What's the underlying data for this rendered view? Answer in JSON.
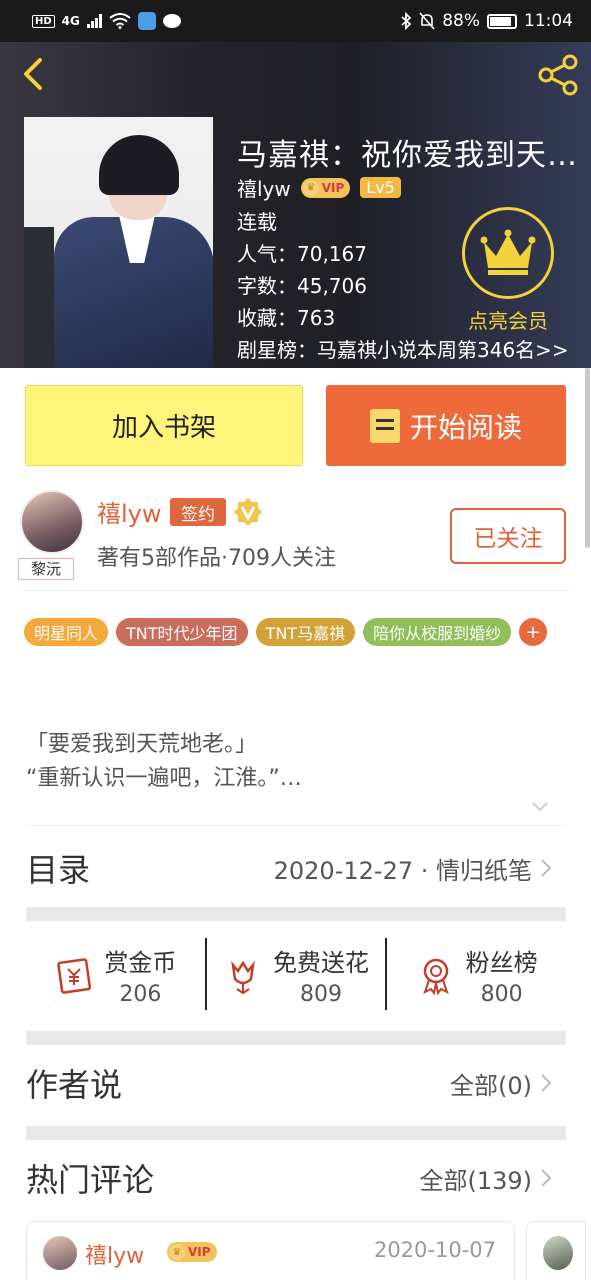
{
  "status_bar": {
    "left_icons": [
      "HD",
      "4G",
      "signal",
      "wifi",
      "app",
      "message"
    ],
    "battery": "88%",
    "time": "11:04"
  },
  "book": {
    "title": "马嘉祺：祝你爱我到天…",
    "author": "禧lyw",
    "vip": "VIP",
    "level": "Lv5",
    "status": "连载",
    "popularity": "人气：70,167",
    "words": "字数：45,706",
    "favorites": "收藏：763",
    "rank": "剧星榜：马嘉祺小说本周第346名>>",
    "member_label": "点亮会员"
  },
  "buttons": {
    "add_shelf": "加入书架",
    "start_read": "开始阅读"
  },
  "author": {
    "name": "禧lyw",
    "signed": "签约",
    "avatar_tag": "黎沅",
    "stats": "著有5部作品·709人关注",
    "follow": "已关注"
  },
  "tags": [
    {
      "label": "明星同人",
      "color": "#f5a93c"
    },
    {
      "label": "TNT时代少年团",
      "color": "#c86e5a"
    },
    {
      "label": "TNT马嘉祺",
      "color": "#d2a238"
    },
    {
      "label": "陪你从校服到婚纱",
      "color": "#8fbf58"
    }
  ],
  "tag_add": "+",
  "synopsis": {
    "line1": "「要爱我到天荒地老。」",
    "line2": "“重新认识一遍吧，江淮。”…"
  },
  "catalog": {
    "title": "目录",
    "latest": "2020-12-27 · 情归纸笔"
  },
  "actions": [
    {
      "label": "赏金币",
      "count": "206",
      "icon": "reward-icon"
    },
    {
      "label": "免费送花",
      "count": "809",
      "icon": "flower-icon"
    },
    {
      "label": "粉丝榜",
      "count": "800",
      "icon": "medal-icon"
    }
  ],
  "author_say": {
    "title": "作者说",
    "all": "全部(0)"
  },
  "comments": {
    "title": "热门评论",
    "all": "全部(139)",
    "first": {
      "name": "禧lyw",
      "vip": "VIP",
      "date": "2020-10-07"
    }
  },
  "colors": {
    "accent": "#e0623a",
    "shelf_button": "#fff57a",
    "read_button": "#ef6a3a",
    "member_gold": "#f3d23c"
  }
}
